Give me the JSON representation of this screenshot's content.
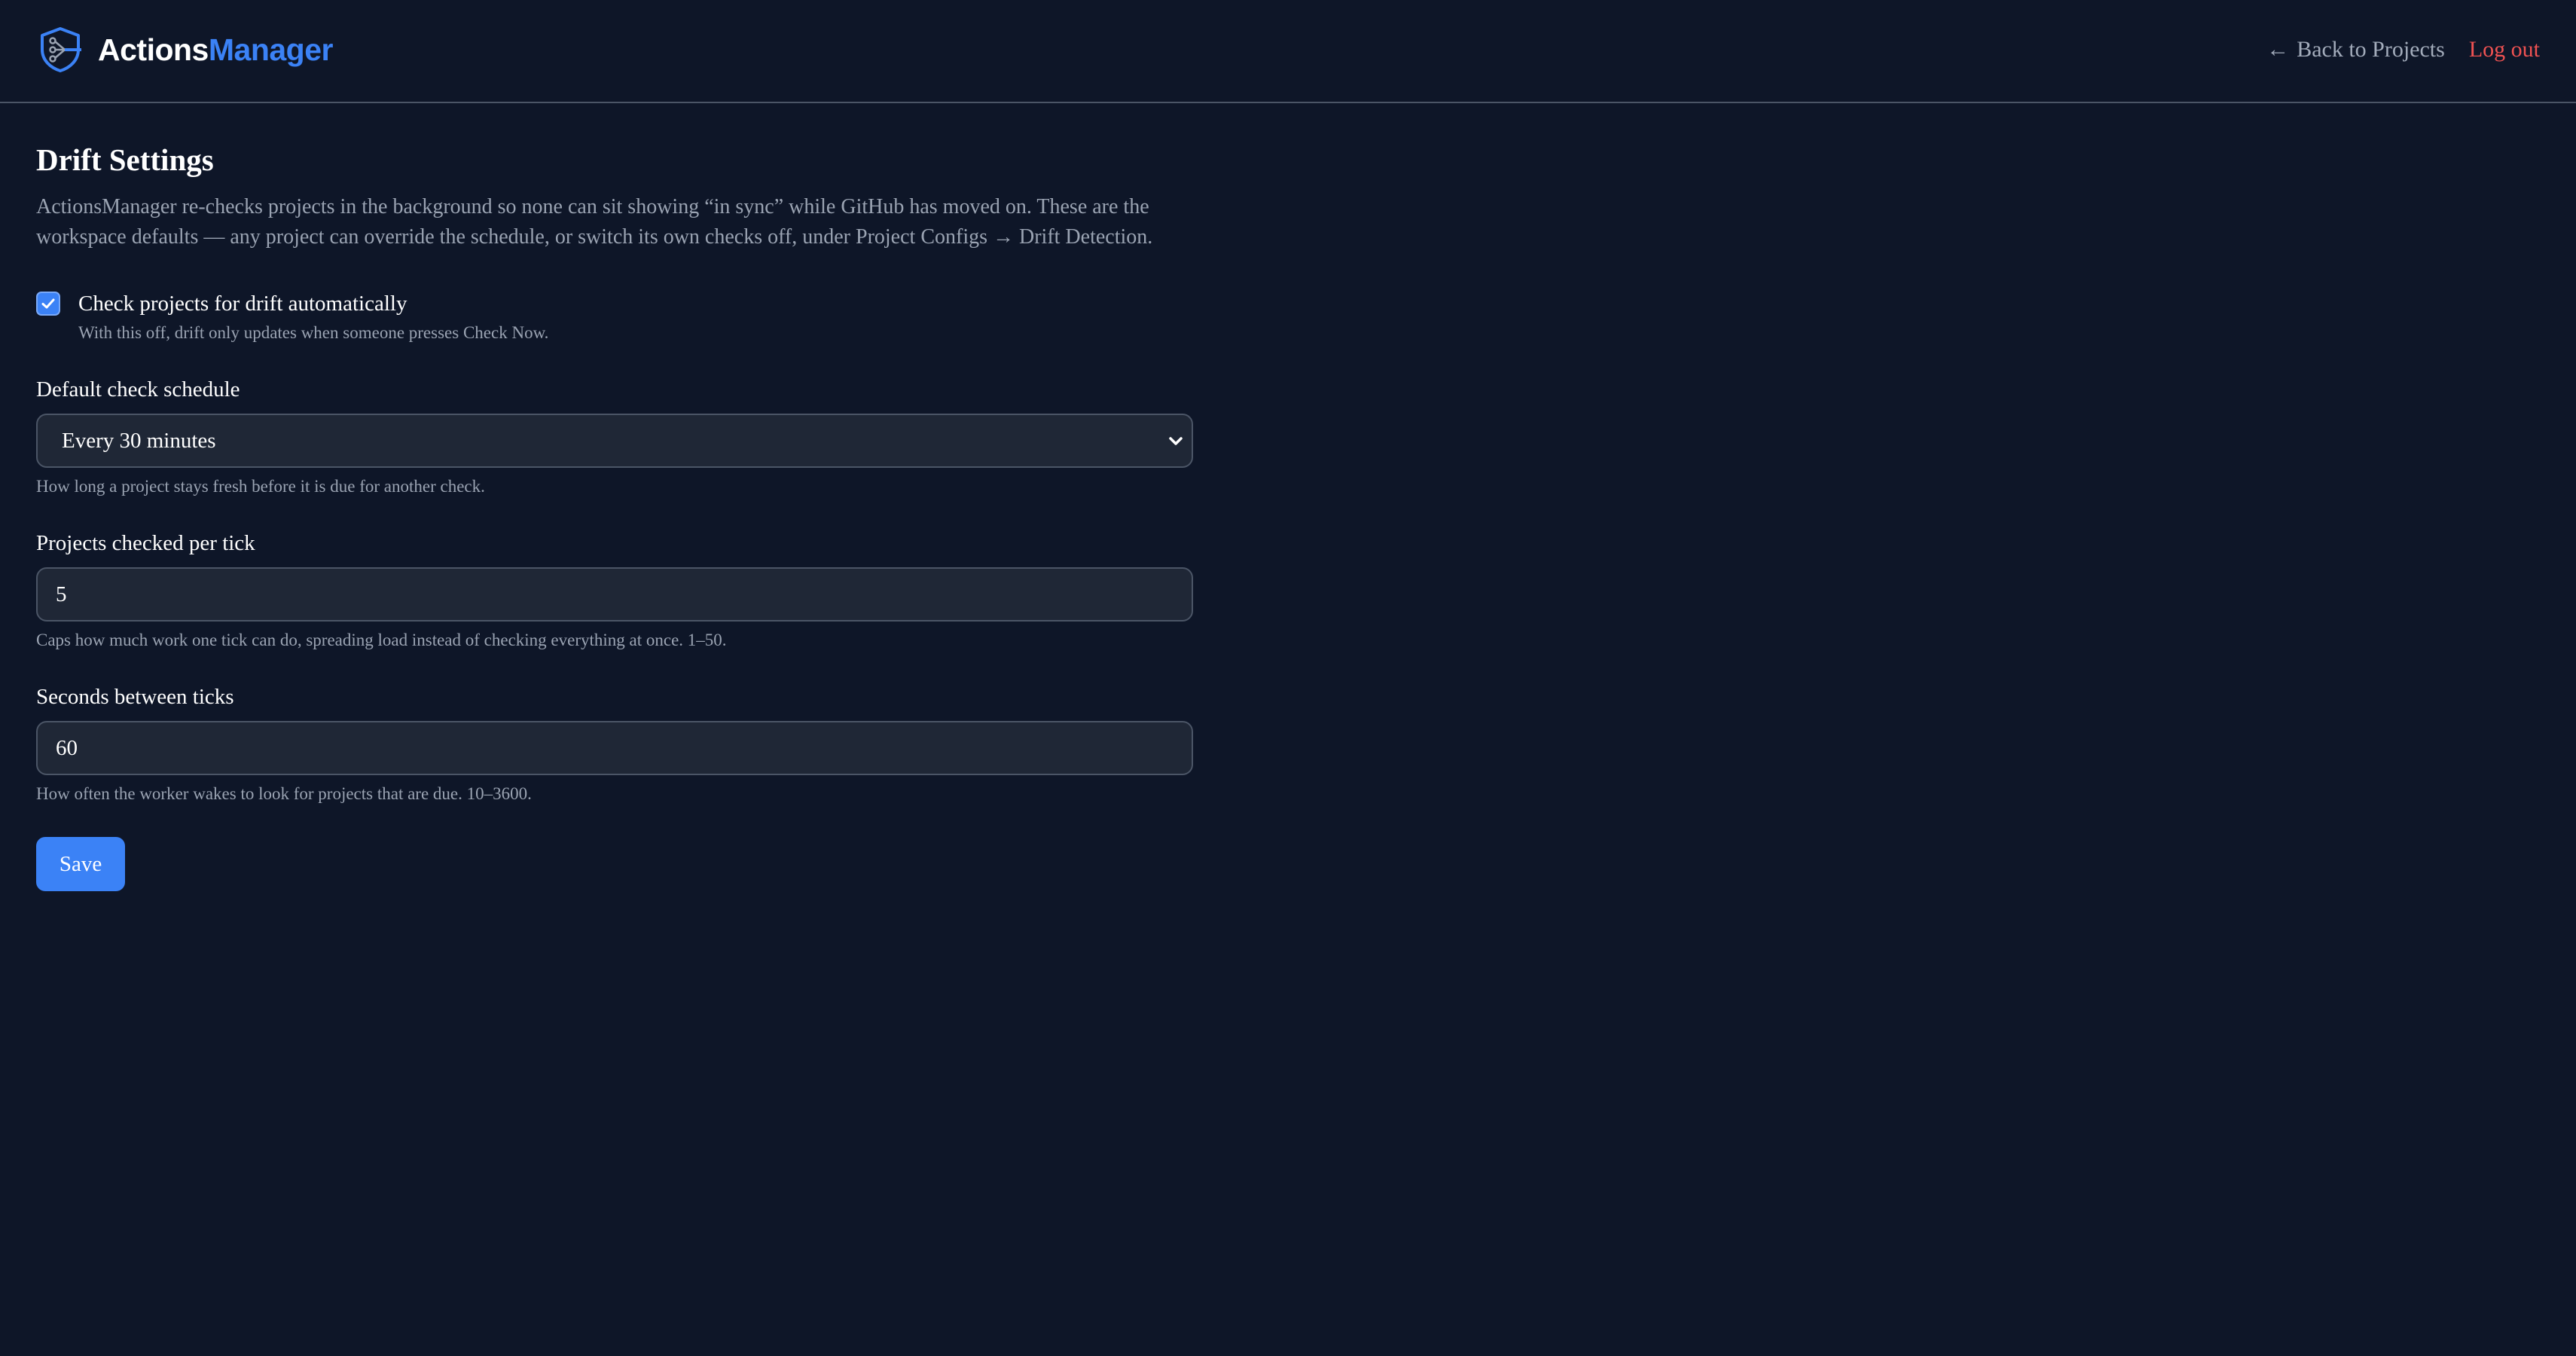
{
  "header": {
    "brand_part1": "Actions",
    "brand_part2": "Manager",
    "logo_icon": "shield-workflow-icon",
    "back_arrow": "←",
    "back_label": "Back to Projects",
    "logout_label": "Log out"
  },
  "page": {
    "title": "Drift Settings",
    "intro": "ActionsManager re-checks projects in the background so none can sit showing “in sync” while GitHub has moved on. These are the workspace defaults — any project can override the schedule, or switch its own checks off, under Project Configs → Drift Detection."
  },
  "auto_check": {
    "checked": true,
    "label": "Check projects for drift automatically",
    "help": "With this off, drift only updates when someone presses Check Now."
  },
  "schedule": {
    "label": "Default check schedule",
    "value": "Every 30 minutes",
    "help": "How long a project stays fresh before it is due for another check."
  },
  "per_tick": {
    "label": "Projects checked per tick",
    "value": "5",
    "help": "Caps how much work one tick can do, spreading load instead of checking everything at once. 1–50."
  },
  "tick_interval": {
    "label": "Seconds between ticks",
    "value": "60",
    "help": "How often the worker wakes to look for projects that are due. 10–3600."
  },
  "actions": {
    "save_label": "Save"
  },
  "colors": {
    "background": "#0e1628",
    "accent": "#3b82f6",
    "danger": "#f05252",
    "input_bg": "#1f2736"
  }
}
